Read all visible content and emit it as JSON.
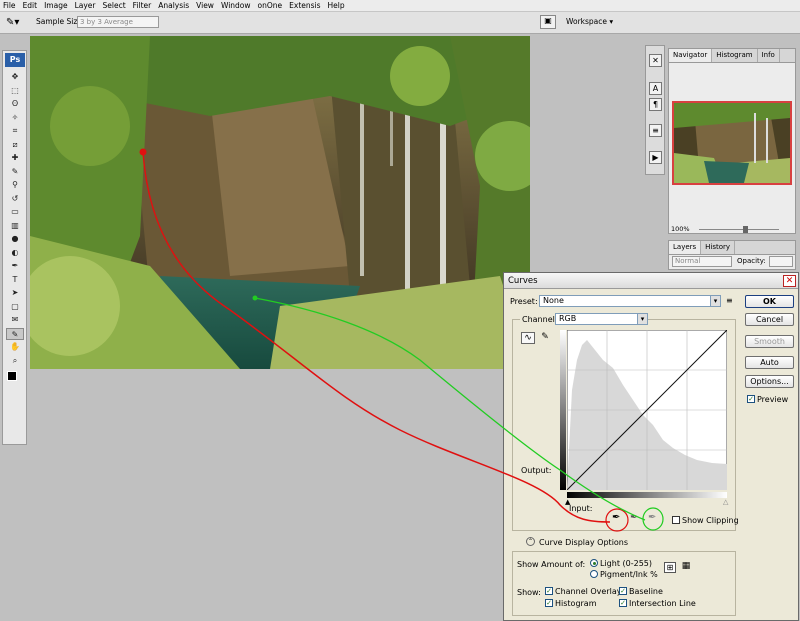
{
  "menubar": {
    "items": [
      "File",
      "Edit",
      "Image",
      "Layer",
      "Select",
      "Filter",
      "Analysis",
      "View",
      "Window",
      "onOne",
      "Extensis",
      "Help"
    ]
  },
  "options": {
    "sample_size_label": "Sample Size:",
    "sample_size_value": "3 by 3 Average",
    "workspace_label": "Workspace"
  },
  "toolbox": {
    "logo": "Ps",
    "tools": [
      "move",
      "marquee",
      "lasso",
      "magic-wand",
      "crop",
      "slice",
      "healing",
      "brush",
      "stamp",
      "history-brush",
      "eraser",
      "gradient",
      "blur",
      "dodge",
      "pen",
      "type",
      "path-select",
      "shape",
      "notes",
      "eyedropper",
      "hand",
      "zoom"
    ]
  },
  "navigator": {
    "tabs": [
      "Navigator",
      "Histogram",
      "Info"
    ],
    "zoom": "100%"
  },
  "layers": {
    "tabs": [
      "Layers",
      "History"
    ],
    "blend_mode": "Normal",
    "opacity_label": "Opacity:"
  },
  "curves": {
    "title": "Curves",
    "preset_label": "Preset:",
    "preset_value": "None",
    "channel_label": "Channel:",
    "channel_value": "RGB",
    "ok": "OK",
    "cancel": "Cancel",
    "smooth": "Smooth",
    "auto": "Auto",
    "options": "Options...",
    "preview": "Preview",
    "output_label": "Output:",
    "input_label": "Input:",
    "show_clipping": "Show Clipping",
    "display_options": "Curve Display Options",
    "show_amount_label": "Show Amount of:",
    "light_option": "Light  (0-255)",
    "pigment_option": "Pigment/Ink %",
    "show_label": "Show:",
    "channel_overlays": "Channel Overlays",
    "baseline": "Baseline",
    "histogram": "Histogram",
    "intersection_line": "Intersection Line"
  },
  "colors": {
    "annotation_red": "#e01010",
    "annotation_green": "#22cc22",
    "dialog_bg": "#ece9d8"
  }
}
